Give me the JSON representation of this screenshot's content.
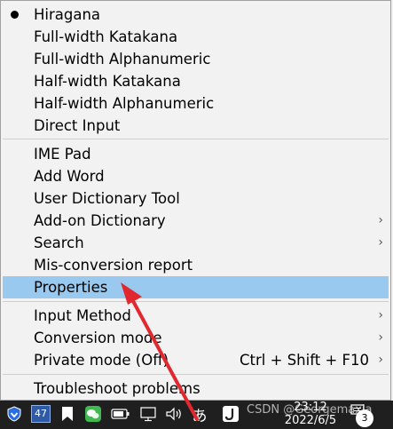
{
  "menu": {
    "items": [
      {
        "label": "Hiragana",
        "selected_mode": true
      },
      {
        "label": "Full-width Katakana"
      },
      {
        "label": "Full-width Alphanumeric"
      },
      {
        "label": "Half-width Katakana"
      },
      {
        "label": "Half-width Alphanumeric"
      },
      {
        "label": "Direct Input"
      },
      {
        "label": "IME Pad"
      },
      {
        "label": "Add Word"
      },
      {
        "label": "User Dictionary Tool"
      },
      {
        "label": "Add-on Dictionary",
        "submenu": "›"
      },
      {
        "label": "Search",
        "submenu": "›"
      },
      {
        "label": "Mis-conversion report"
      },
      {
        "label": "Properties",
        "highlighted": true
      },
      {
        "label": "Input Method",
        "submenu": "›"
      },
      {
        "label": "Conversion mode",
        "submenu": "›"
      },
      {
        "label": "Private mode (Off)",
        "shortcut": "Ctrl + Shift + F10",
        "submenu": "›"
      },
      {
        "label": "Troubleshoot problems"
      }
    ]
  },
  "taskbar": {
    "time": "23:12",
    "date": "2022/6/5",
    "notification_count": "3",
    "ime_indicator": "あ",
    "badge_number": "47",
    "icons": [
      "shield-icon",
      "calendar-icon",
      "bookmark-icon",
      "wechat-icon",
      "battery-icon",
      "display-icon",
      "volume-icon",
      "ime-icon",
      "app-icon",
      "notification-icon"
    ]
  },
  "watermark": "CSDN @Georgemaxia",
  "colors": {
    "highlight": "#99c9ef",
    "menu_bg": "#f2f2f2",
    "taskbar_bg": "#1f1f1f",
    "arrow": "#e0282e"
  }
}
